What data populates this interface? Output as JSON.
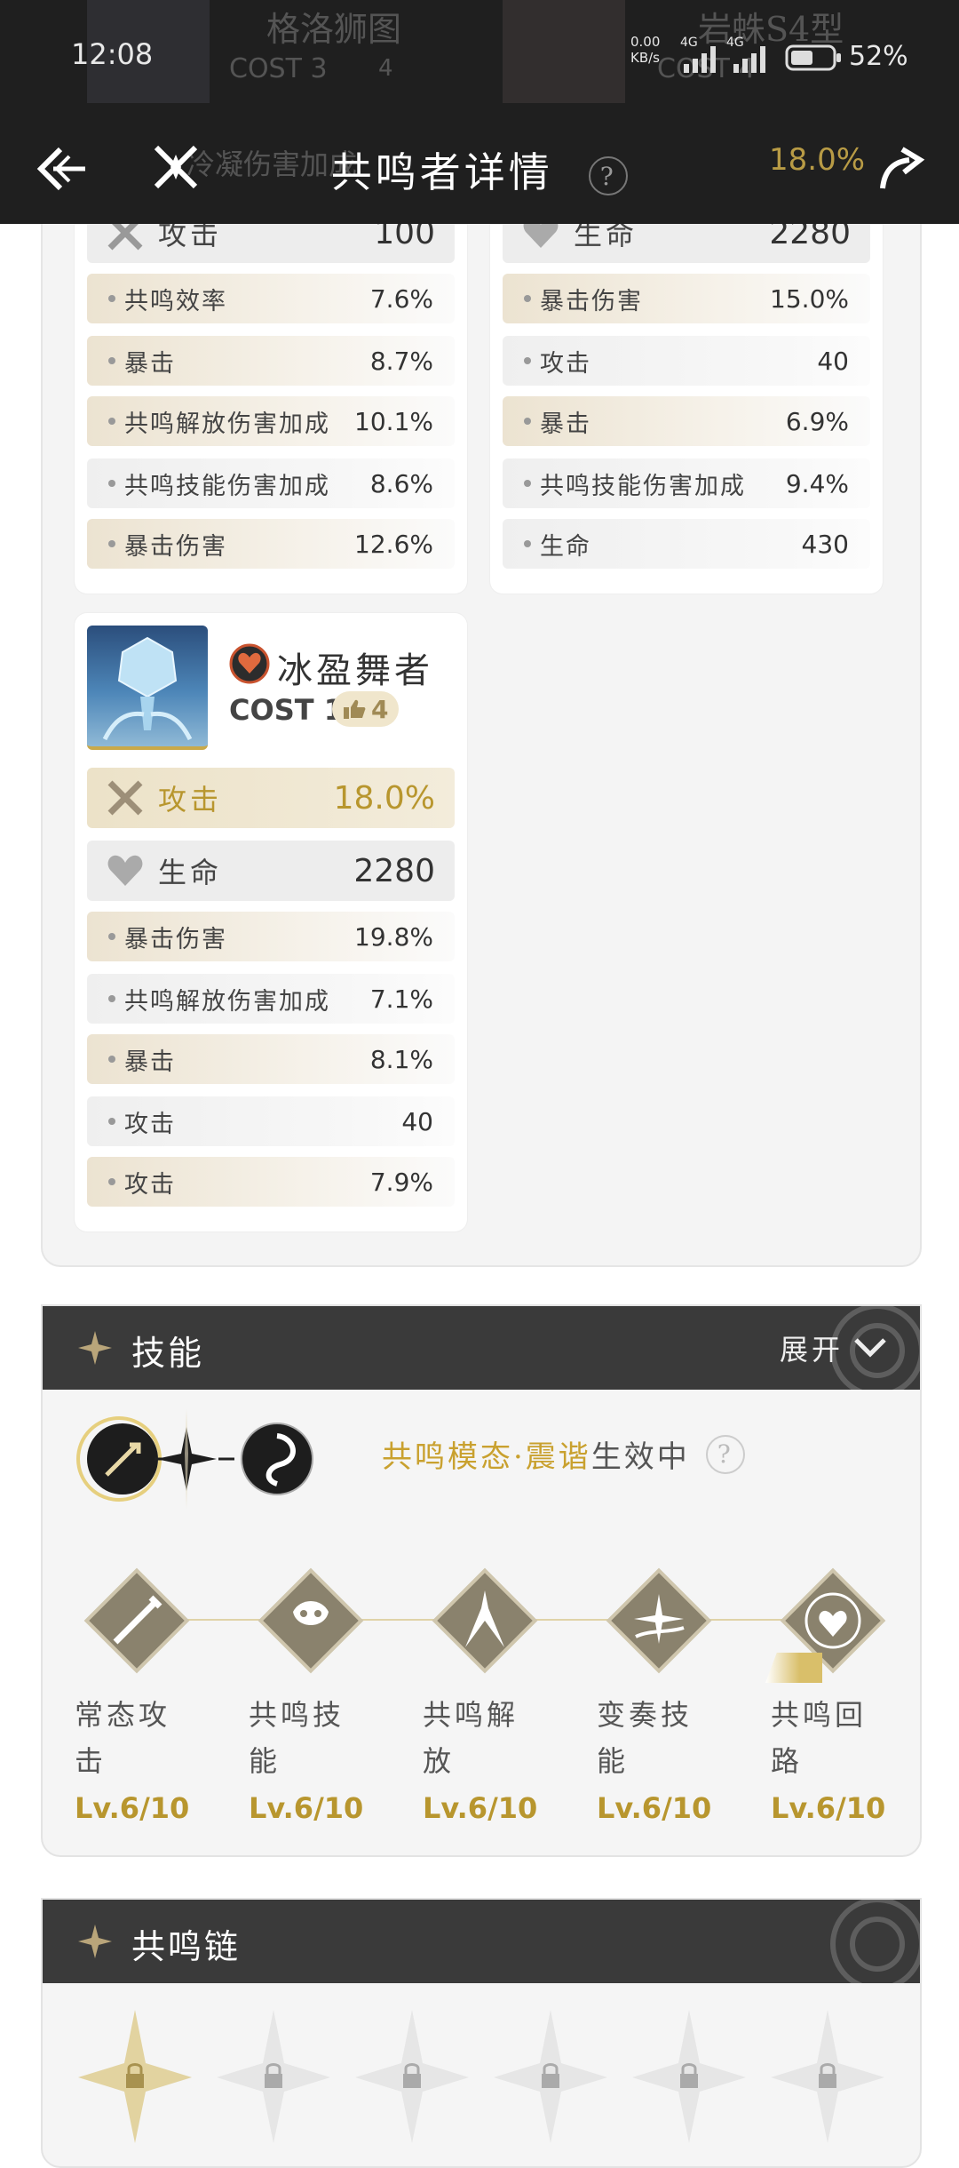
{
  "status_bar": {
    "time": "12:08",
    "net_speed": "0.00\nKB/s",
    "net_type_1": "4G",
    "net_type_2": "4G",
    "battery": "52%"
  },
  "header": {
    "title": "共鸣者详情",
    "help": "?",
    "bg_echo_left": {
      "name": "格洛狮图",
      "cost": "COST 3",
      "count": "4"
    },
    "bg_echo_right": {
      "name": "岩蛛S4型",
      "cost": "COST 4"
    },
    "bg_row_left": "冷凝伤害加成",
    "bg_row_right_value": "18.0%"
  },
  "echo_top_left": {
    "main": {
      "label": "攻击",
      "value": "100"
    },
    "subs": [
      {
        "label": "共鸣效率",
        "value": "7.6%"
      },
      {
        "label": "暴击",
        "value": "8.7%"
      },
      {
        "label": "共鸣解放伤害加成",
        "value": "10.1%"
      },
      {
        "label": "共鸣技能伤害加成",
        "value": "8.6%"
      },
      {
        "label": "暴击伤害",
        "value": "12.6%"
      }
    ]
  },
  "echo_top_right": {
    "main": {
      "label": "生命",
      "value": "2280"
    },
    "subs": [
      {
        "label": "暴击伤害",
        "value": "15.0%"
      },
      {
        "label": "攻击",
        "value": "40"
      },
      {
        "label": "暴击",
        "value": "6.9%"
      },
      {
        "label": "共鸣技能伤害加成",
        "value": "9.4%"
      },
      {
        "label": "生命",
        "value": "430"
      }
    ]
  },
  "echo_bottom": {
    "name": "冰盈舞者",
    "cost": "COST 1",
    "count": "4",
    "main1": {
      "label": "攻击",
      "value": "18.0%"
    },
    "main2": {
      "label": "生命",
      "value": "2280"
    },
    "subs": [
      {
        "label": "暴击伤害",
        "value": "19.8%"
      },
      {
        "label": "共鸣解放伤害加成",
        "value": "7.1%"
      },
      {
        "label": "暴击",
        "value": "8.1%"
      },
      {
        "label": "攻击",
        "value": "40"
      },
      {
        "label": "攻击",
        "value": "7.9%"
      }
    ]
  },
  "skills_section": {
    "title": "技能",
    "expand": "展开",
    "mode_prefix": "共鸣模态·震谐",
    "mode_suffix": "生效中",
    "help": "?",
    "skills": [
      {
        "name": "常态攻击",
        "level": "Lv.6/10"
      },
      {
        "name": "共鸣技能",
        "level": "Lv.6/10"
      },
      {
        "name": "共鸣解放",
        "level": "Lv.6/10"
      },
      {
        "name": "变奏技能",
        "level": "Lv.6/10"
      },
      {
        "name": "共鸣回路",
        "level": "Lv.6/10"
      }
    ]
  },
  "chain_section": {
    "title": "共鸣链"
  },
  "colors": {
    "gold": "#b8962e",
    "dark": "#3a3a3a",
    "topbar": "#1f1f1f"
  }
}
